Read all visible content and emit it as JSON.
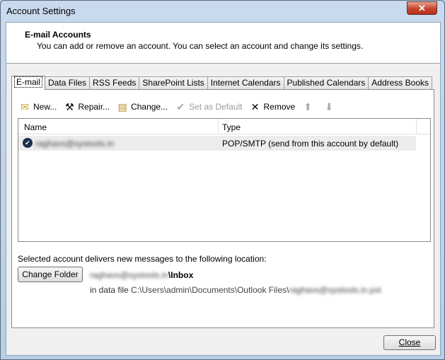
{
  "window": {
    "title": "Account Settings",
    "close_icon": "close-icon"
  },
  "header": {
    "title": "E-mail Accounts",
    "description": "You can add or remove an account. You can select an account and change its settings."
  },
  "tabs": [
    {
      "label": "E-mail",
      "active": true
    },
    {
      "label": "Data Files"
    },
    {
      "label": "RSS Feeds"
    },
    {
      "label": "SharePoint Lists"
    },
    {
      "label": "Internet Calendars"
    },
    {
      "label": "Published Calendars"
    },
    {
      "label": "Address Books"
    }
  ],
  "toolbar": {
    "new": "New...",
    "repair": "Repair...",
    "change": "Change...",
    "set_default": "Set as Default",
    "remove": "Remove"
  },
  "list": {
    "columns": [
      "Name",
      "Type"
    ],
    "rows": [
      {
        "name": "raghavs@systools.in",
        "type": "POP/SMTP (send from this account by default)"
      }
    ]
  },
  "delivery": {
    "label": "Selected account delivers new messages to the following location:",
    "change_folder": "Change Folder",
    "account": "raghavs@systools.in",
    "folder": "\\Inbox",
    "data_file_prefix": "in data file ",
    "path": "C:\\Users\\admin\\Documents\\Outlook Files\\",
    "file": "raghavs@systools.in.pst"
  },
  "footer": {
    "close": "Close"
  }
}
